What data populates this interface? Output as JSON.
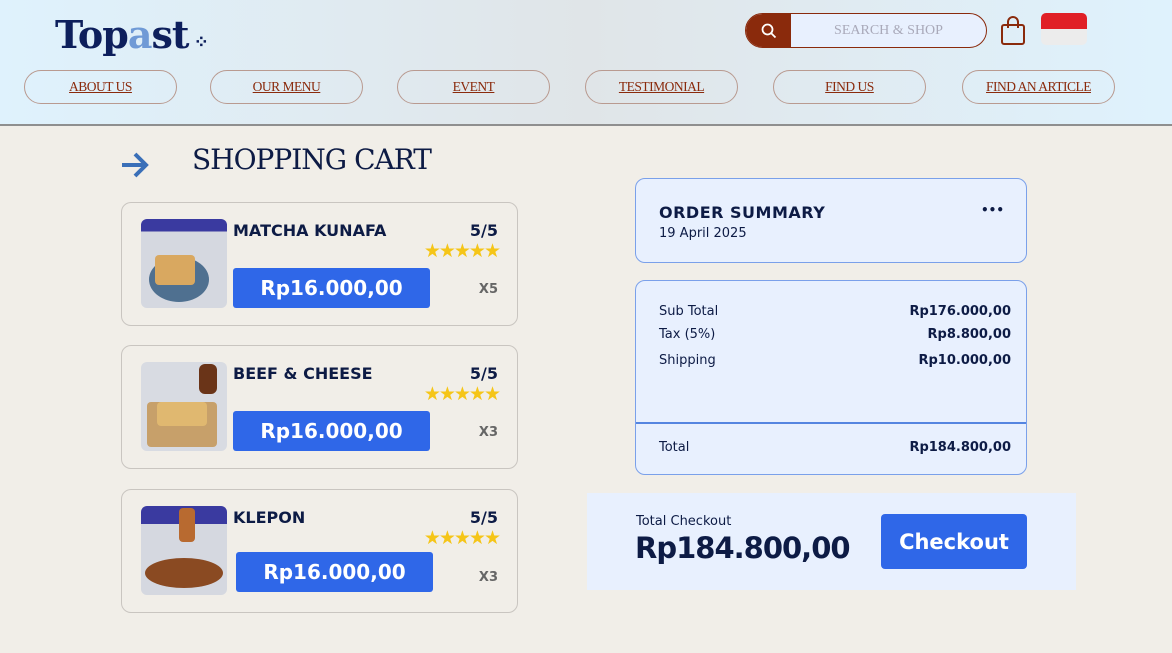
{
  "header": {
    "logo_main": "Top",
    "logo_accent": "a",
    "logo_end": "st",
    "search_placeholder": "SEARCH & SHOP",
    "nav": [
      "ABOUT US",
      "OUR MENU",
      "EVENT",
      "TESTIMONIAL",
      "FIND US",
      "FIND AN ARTICLE"
    ]
  },
  "cart": {
    "title": "SHOPPING CART",
    "items": [
      {
        "name": "MATCHA KUNAFA",
        "rating": "5/5",
        "stars": "★★★★★",
        "price": "Rp16.000,00",
        "qty": "X5"
      },
      {
        "name": "BEEF & CHEESE",
        "rating": "5/5",
        "stars": "★★★★★",
        "price": "Rp16.000,00",
        "qty": "X3"
      },
      {
        "name": "KLEPON",
        "rating": "5/5",
        "stars": "★★★★★",
        "price": "Rp16.000,00",
        "qty": "X3"
      }
    ]
  },
  "summary": {
    "title": "ORDER SUMMARY",
    "date": "19 April 2025",
    "more": "•••",
    "subtotal_label": "Sub Total",
    "subtotal": "Rp176.000,00",
    "tax_label": "Tax (5%)",
    "tax": "Rp8.800,00",
    "shipping_label": "Shipping",
    "shipping": "Rp10.000,00",
    "total_label": "Total",
    "total": "Rp184.800,00"
  },
  "checkout": {
    "label": "Total Checkout",
    "amount": "Rp184.800,00",
    "button": "Checkout"
  },
  "colors": {
    "brand": "#2f67e8",
    "navy": "#0d1b45",
    "brown": "#8a2a0c"
  }
}
